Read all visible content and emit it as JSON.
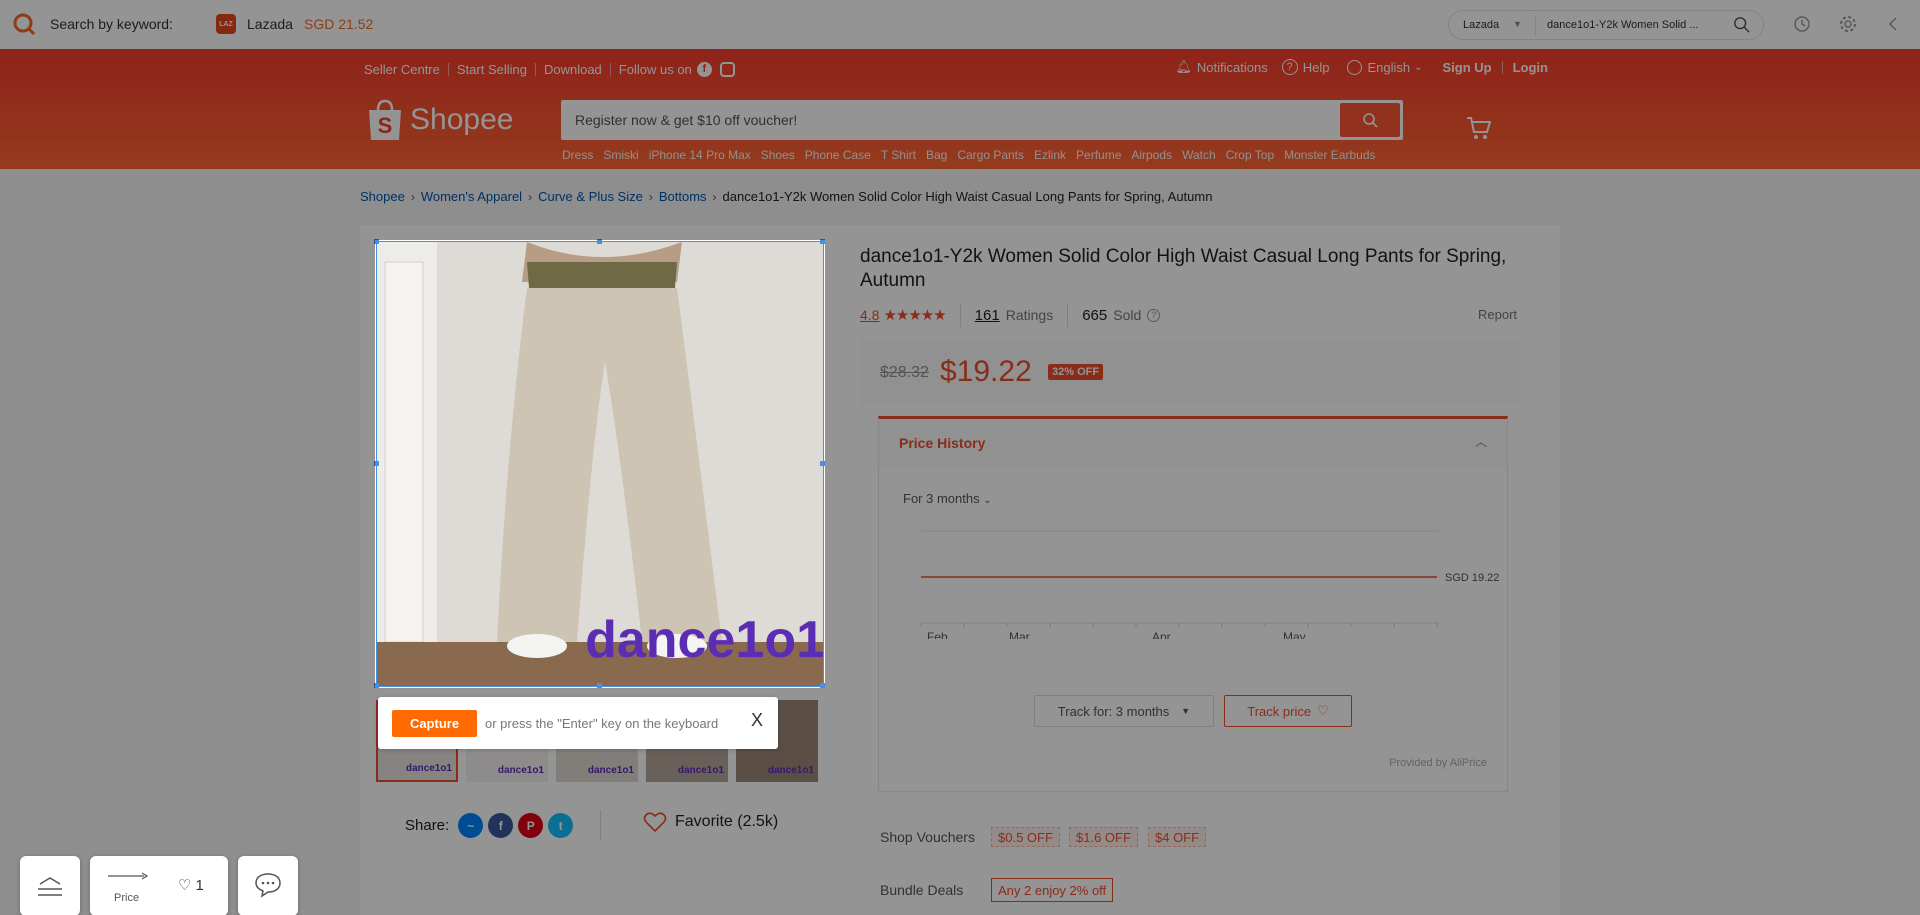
{
  "ext": {
    "search_label": "Search by keyword:",
    "laz_badge": "LAZ",
    "laz_name": "Lazada",
    "laz_price": "SGD 21.52",
    "store_select": "Lazada",
    "query": "dance1o1-Y2k Women Solid ..."
  },
  "header": {
    "top_links": [
      "Seller Centre",
      "Start Selling",
      "Download",
      "Follow us on"
    ],
    "notifications": "Notifications",
    "help": "Help",
    "language": "English",
    "signup": "Sign Up",
    "login": "Login",
    "logo_text": "Shopee",
    "search_placeholder": "Register now & get $10 off voucher!",
    "hints": [
      "Dress",
      "Smiski",
      "iPhone 14 Pro Max",
      "Shoes",
      "Phone Case",
      "T Shirt",
      "Bag",
      "Cargo Pants",
      "Ezlink",
      "Perfume",
      "Airpods",
      "Watch",
      "Crop Top",
      "Monster Earbuds"
    ]
  },
  "breadcrumb": [
    "Shopee",
    "Women's Apparel",
    "Curve & Plus Size",
    "Bottoms",
    "dance1o1-Y2k Women Solid Color High Waist Casual Long Pants for Spring, Autumn"
  ],
  "product": {
    "title": "dance1o1-Y2k Women Solid Color High Waist Casual Long Pants for Spring, Autumn",
    "rating": "4.8",
    "stars": "★★★★★",
    "ratings_count": "161",
    "ratings_label": "Ratings",
    "sold_count": "665",
    "sold_label": "Sold",
    "report": "Report",
    "old_price": "$28.32",
    "price": "$19.22",
    "off": "32% OFF",
    "watermark": "dance1o1"
  },
  "capture": {
    "button": "Capture",
    "text": "or press the \"Enter\" key on the keyboard",
    "close": "X"
  },
  "share": {
    "label": "Share:",
    "favorite": "Favorite (2.5k)"
  },
  "price_history": {
    "title": "Price History",
    "period": "For 3 months",
    "price_label": "SGD 19.22",
    "months": [
      "Feb",
      "Mar",
      "Apr",
      "May"
    ],
    "track_for": "Track for: 3 months",
    "track_price": "Track price",
    "provided": "Provided by AliPrice"
  },
  "chart_data": {
    "type": "line",
    "x": [
      "Feb",
      "Mar",
      "Apr",
      "May"
    ],
    "series": [
      {
        "values": [
          19.22,
          19.22,
          19.22,
          19.22
        ]
      }
    ]
  },
  "vouchers": {
    "label": "Shop Vouchers",
    "items": [
      "$0.5 OFF",
      "$1.6 OFF",
      "$4 OFF"
    ]
  },
  "bundle": {
    "label": "Bundle Deals",
    "tag": "Any 2 enjoy 2% off"
  },
  "widgets": {
    "price_label": "Price",
    "fav_count": "1"
  },
  "colors": {
    "brand": "#ee4d2d",
    "capture": "#ff6a00"
  }
}
